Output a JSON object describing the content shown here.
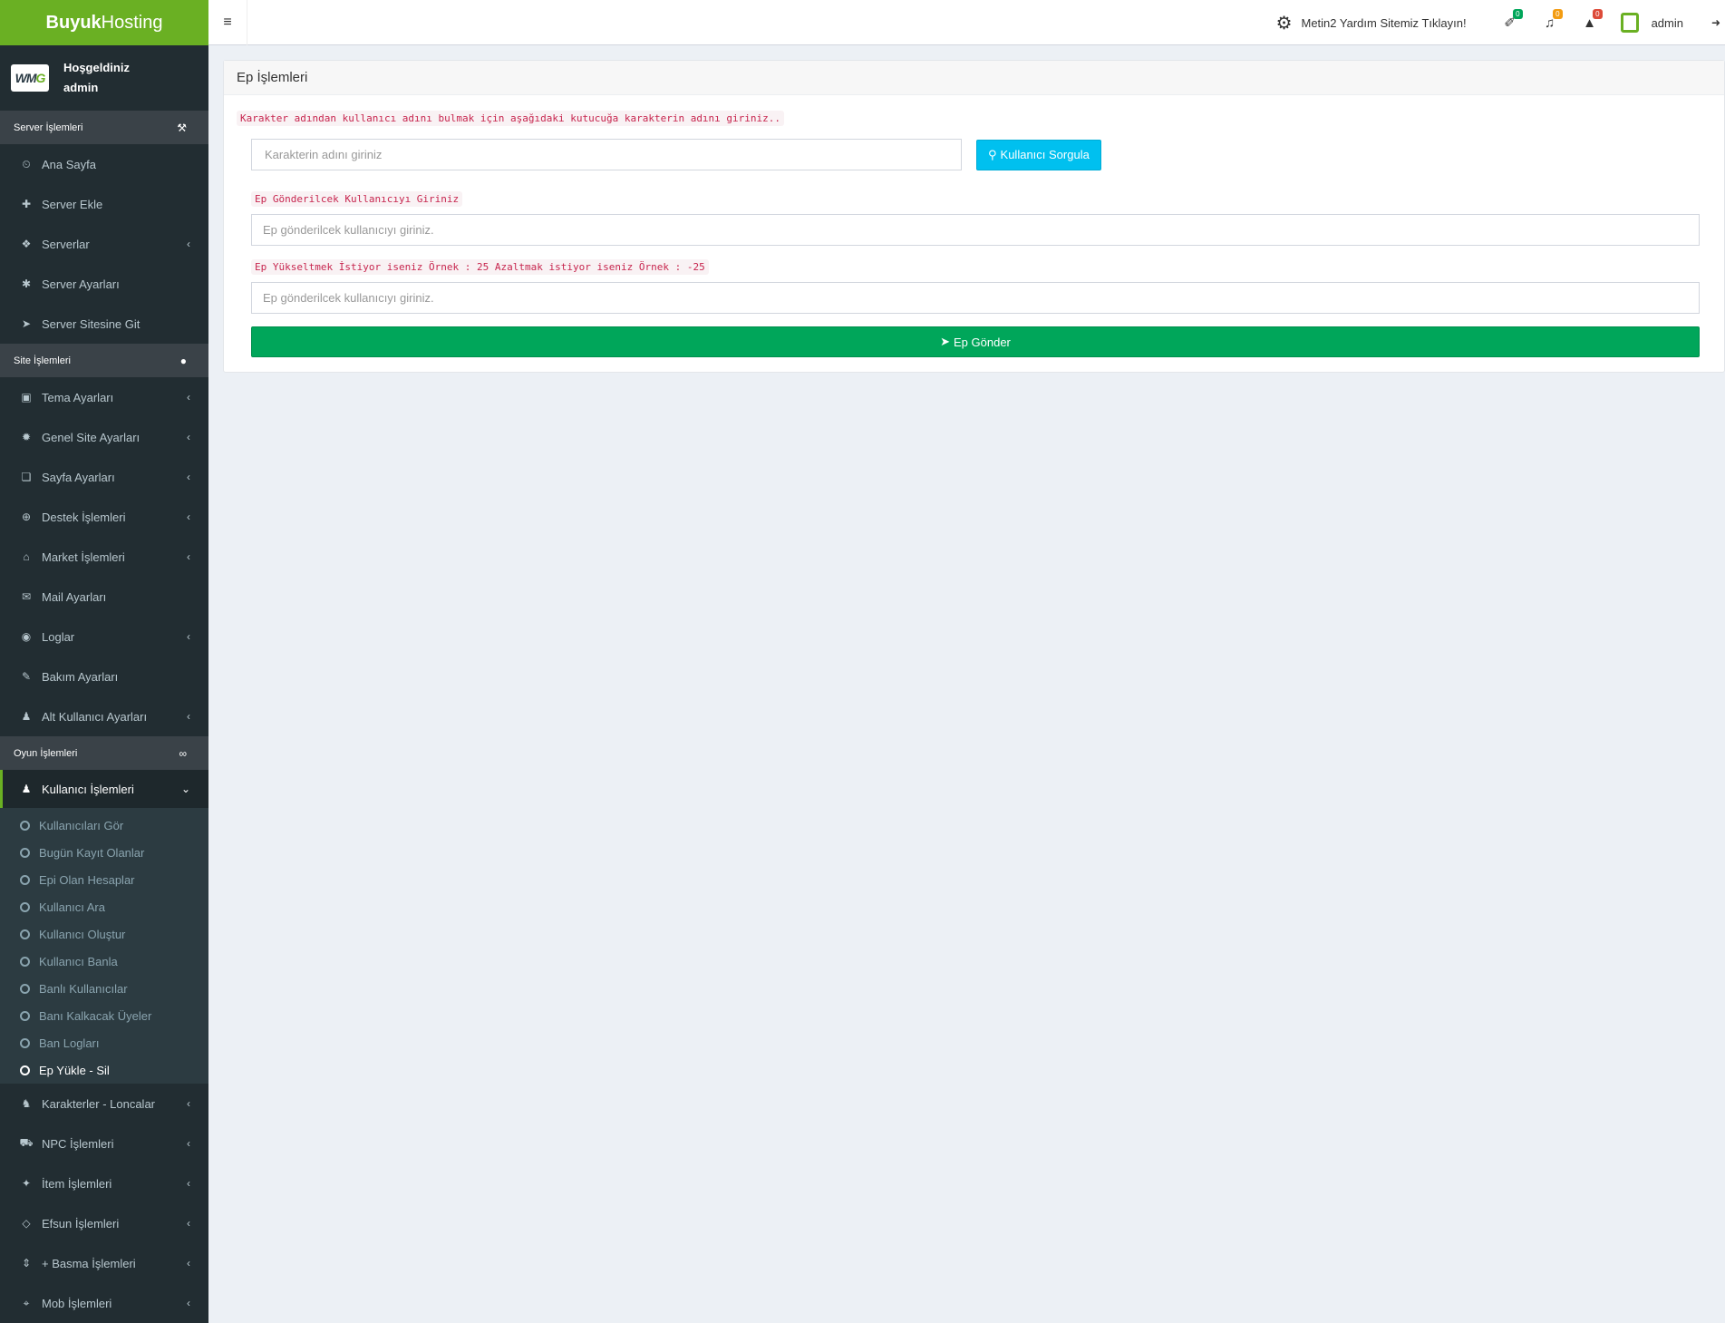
{
  "brand": {
    "name_bold": "Buyuk",
    "name_light": "Hosting"
  },
  "user_panel": {
    "logo_text_1": "WM",
    "logo_text_2": "G",
    "welcome": "Hoşgeldiniz",
    "username": "admin"
  },
  "sections": {
    "server": {
      "label": "Server İşlemleri",
      "icon": "wrench-icon"
    },
    "site": {
      "label": "Site İşlemleri",
      "icon": "globe-icon"
    },
    "game": {
      "label": "Oyun İşlemleri",
      "icon": "gamepad-icon"
    }
  },
  "server_menu": [
    {
      "label": "Ana Sayfa",
      "icon": "dashboard-icon",
      "glyph": "⏲",
      "chevron": false
    },
    {
      "label": "Server Ekle",
      "icon": "plus-icon",
      "glyph": "✚",
      "chevron": false
    },
    {
      "label": "Serverlar",
      "icon": "cubes-icon",
      "glyph": "❖",
      "chevron": true
    },
    {
      "label": "Server Ayarları",
      "icon": "settings-icon",
      "glyph": "✱",
      "chevron": false
    },
    {
      "label": "Server Sitesine Git",
      "icon": "paper-plane-icon",
      "glyph": "➤",
      "chevron": false
    }
  ],
  "site_menu": [
    {
      "label": "Tema Ayarları",
      "icon": "image-icon",
      "glyph": "▣",
      "chevron": true
    },
    {
      "label": "Genel Site Ayarları",
      "icon": "gear-icon",
      "glyph": "✹",
      "chevron": true
    },
    {
      "label": "Sayfa Ayarları",
      "icon": "file-icon",
      "glyph": "❏",
      "chevron": true
    },
    {
      "label": "Destek İşlemleri",
      "icon": "life-ring-icon",
      "glyph": "⊕",
      "chevron": true
    },
    {
      "label": "Market İşlemleri",
      "icon": "basket-icon",
      "glyph": "⌂",
      "chevron": true
    },
    {
      "label": "Mail Ayarları",
      "icon": "envelope-icon",
      "glyph": "✉",
      "chevron": false
    },
    {
      "label": "Loglar",
      "icon": "eye-icon",
      "glyph": "◉",
      "chevron": true
    },
    {
      "label": "Bakım Ayarları",
      "icon": "eraser-icon",
      "glyph": "✎",
      "chevron": false
    },
    {
      "label": "Alt Kullanıcı Ayarları",
      "icon": "user-icon",
      "glyph": "♟",
      "chevron": true
    }
  ],
  "game_active": {
    "label": "Kullanıcı İşlemleri",
    "icon": "user-icon",
    "glyph": "♟"
  },
  "game_submenu": [
    {
      "label": "Kullanıcıları Gör",
      "current": false
    },
    {
      "label": "Bugün Kayıt Olanlar",
      "current": false
    },
    {
      "label": "Epi Olan Hesaplar",
      "current": false
    },
    {
      "label": "Kullanıcı Ara",
      "current": false
    },
    {
      "label": "Kullanıcı Oluştur",
      "current": false
    },
    {
      "label": "Kullanıcı Banla",
      "current": false
    },
    {
      "label": "Banlı Kullanıcılar",
      "current": false
    },
    {
      "label": "Banı Kalkacak Üyeler",
      "current": false
    },
    {
      "label": "Ban Logları",
      "current": false
    },
    {
      "label": "Ep Yükle - Sil",
      "current": true
    }
  ],
  "game_menu": [
    {
      "label": "Karakterler - Loncalar",
      "icon": "users-icon",
      "glyph": "♞",
      "chevron": true
    },
    {
      "label": "NPC İşlemleri",
      "icon": "cart-icon",
      "glyph": "⛟",
      "chevron": true
    },
    {
      "label": "İtem İşlemleri",
      "icon": "magic-icon",
      "glyph": "✦",
      "chevron": true
    },
    {
      "label": "Efsun İşlemleri",
      "icon": "diamond-icon",
      "glyph": "◇",
      "chevron": true
    },
    {
      "label": "+ Basma İşlemleri",
      "icon": "sort-icon",
      "glyph": "⇕",
      "chevron": true
    },
    {
      "label": "Mob İşlemleri",
      "icon": "crosshairs-icon",
      "glyph": "⌖",
      "chevron": true
    }
  ],
  "navbar": {
    "help_text": "Metin2 Yardım Sitemiz Tıklayın!",
    "ticket_badge": "0",
    "bell_badge": "0",
    "warning_badge": "0",
    "username": "admin"
  },
  "panel": {
    "title": "Ep İşlemleri",
    "search_hint": "Karakter adından kullanıcı adını bulmak için aşağıdaki kutucuğa karakterin adını giriniz..",
    "search_placeholder": "Karakterin adını giriniz",
    "search_button": "Kullanıcı Sorgula",
    "user_label": "Ep Gönderilcek Kullanıcıyı Giriniz",
    "user_placeholder": "Ep gönderilcek kullanıcıyı giriniz.",
    "amount_label": "Ep Yükseltmek İstiyor iseniz Örnek : 25 Azaltmak istiyor iseniz Örnek : -25",
    "amount_placeholder": "Ep gönderilcek kullanıcıyı giriniz.",
    "submit_button": "Ep Gönder"
  },
  "colors": {
    "brand": "#6ab023",
    "sidebar": "#222d32",
    "info": "#00c0ef",
    "success": "#00a65a"
  }
}
